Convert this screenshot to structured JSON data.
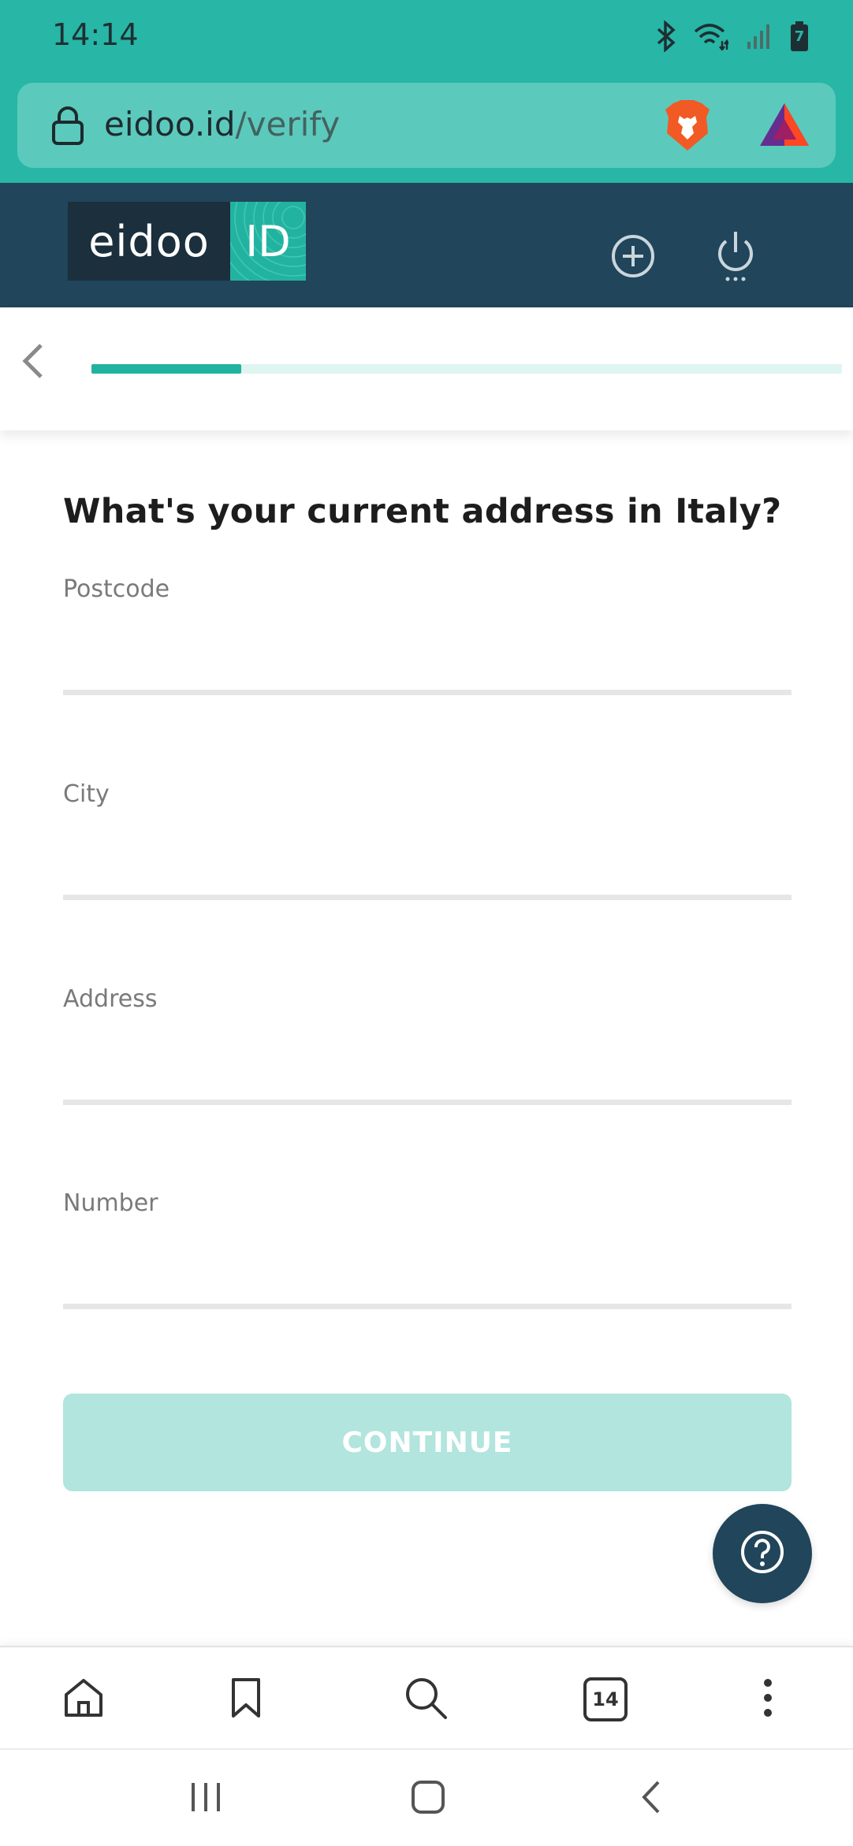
{
  "status_bar": {
    "time": "14:14",
    "icons": [
      "bluetooth-icon",
      "wifi-icon",
      "signal-icon",
      "battery-icon"
    ],
    "battery_level": "7"
  },
  "browser": {
    "url_host": "eidoo.id",
    "url_path": "/verify",
    "tab_count": "14"
  },
  "app": {
    "logo_left": "eidoo",
    "logo_right": "ID"
  },
  "progress": {
    "fraction": 0.2
  },
  "form": {
    "question": "What's your current address in Italy?",
    "fields": [
      {
        "label": "Postcode",
        "value": ""
      },
      {
        "label": "City",
        "value": ""
      },
      {
        "label": "Address",
        "value": ""
      },
      {
        "label": "Number",
        "value": ""
      }
    ],
    "continue_label": "CONTINUE"
  },
  "colors": {
    "teal": "#28b6a6",
    "navy": "#21455a",
    "accent": "#22b3a0",
    "button_disabled": "#b1e5de"
  }
}
